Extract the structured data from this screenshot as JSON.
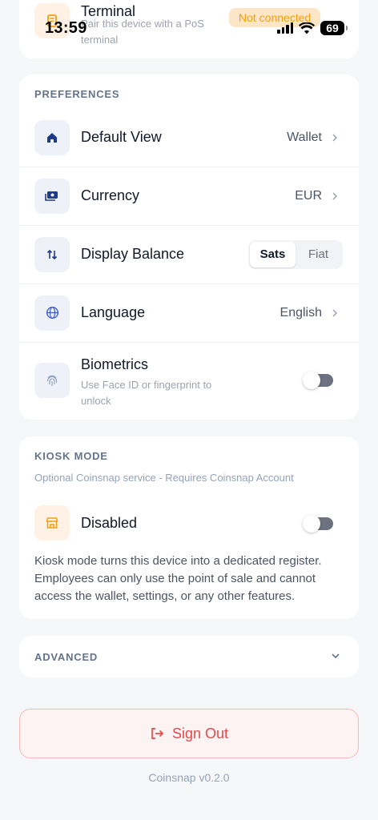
{
  "status_bar": {
    "time": "13:59",
    "battery": "69"
  },
  "terminal": {
    "title": "Terminal",
    "subtitle": "Pair this device with a PoS terminal",
    "badge": "Not connected"
  },
  "preferences": {
    "header": "PREFERENCES",
    "default_view": {
      "label": "Default View",
      "value": "Wallet"
    },
    "currency": {
      "label": "Currency",
      "value": "EUR"
    },
    "display_balance": {
      "label": "Display Balance",
      "options": [
        "Sats",
        "Fiat"
      ],
      "selected": "Sats"
    },
    "language": {
      "label": "Language",
      "value": "English"
    },
    "biometrics": {
      "label": "Biometrics",
      "subtitle": "Use Face ID or fingerprint to unlock",
      "enabled": false
    }
  },
  "kiosk": {
    "header": "KIOSK MODE",
    "subtitle": "Optional Coinsnap service - Requires Coinsnap Account",
    "status_label": "Disabled",
    "enabled": false,
    "description": "Kiosk mode turns this device into a dedicated register. Employees can only use the point of sale and cannot access the wallet, settings, or any other features."
  },
  "advanced": {
    "header": "ADVANCED"
  },
  "sign_out": {
    "label": "Sign Out"
  },
  "version": "Coinsnap v0.2.0",
  "colors": {
    "accent_blue": "#1e3a8a",
    "orange": "#f59e0b",
    "danger": "#e24b4b",
    "background": "#f6f7f9"
  },
  "icons": {
    "terminal": "pos-terminal-icon",
    "default_view": "home-icon",
    "currency": "banknote-icon",
    "display_balance": "arrows-up-down-icon",
    "language": "globe-icon",
    "biometrics": "fingerprint-icon",
    "kiosk": "store-icon",
    "sign_out": "logout-icon"
  }
}
